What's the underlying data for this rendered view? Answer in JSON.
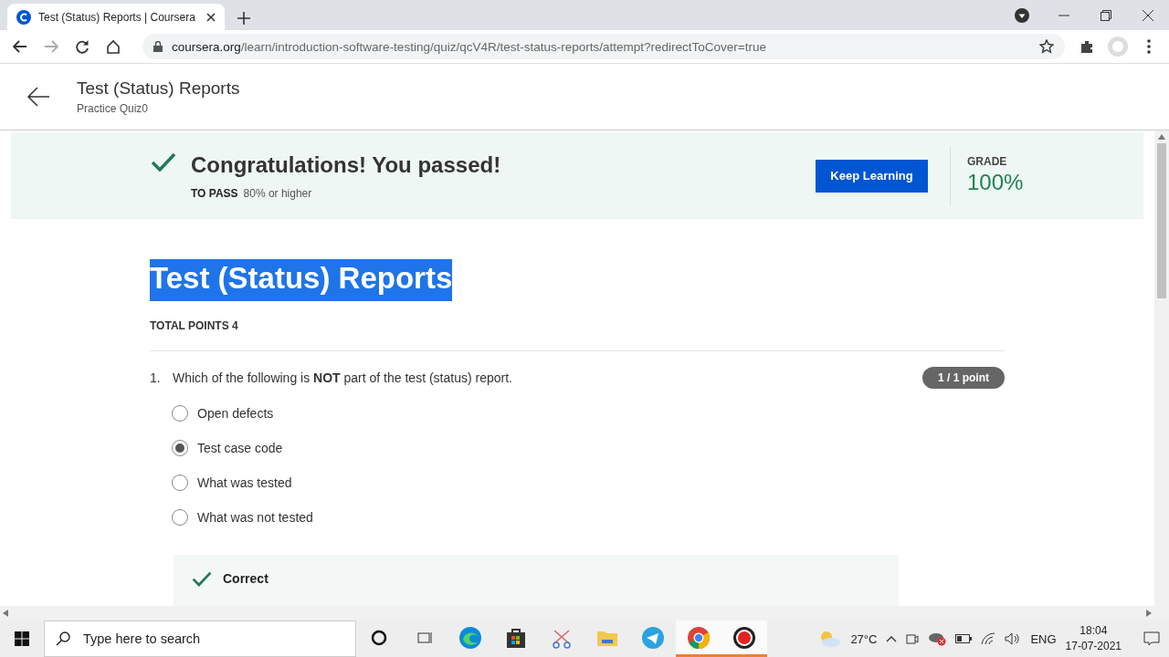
{
  "browser": {
    "tab": {
      "title": "Test (Status) Reports | Coursera",
      "selected": true
    },
    "url": {
      "host": "coursera.org",
      "path": "/learn/introduction-software-testing/quiz/qcV4R/test-status-reports/attempt?redirectToCover=true"
    }
  },
  "header": {
    "title": "Test (Status) Reports",
    "subtitle": "Practice Quiz0"
  },
  "result": {
    "heading": "Congratulations! You passed!",
    "pass_label": "TO PASS",
    "pass_value": "80% or higher",
    "button": "Keep Learning",
    "grade_label": "GRADE",
    "grade_value": "100%"
  },
  "quiz": {
    "title": "Test (Status) Reports",
    "title_highlighted": true,
    "total_points": "TOTAL POINTS 4",
    "questions": [
      {
        "number": "1.",
        "text": "Which of the following is  **NOT** part of the test (status) report.",
        "score": "1 / 1 point",
        "options": [
          {
            "label": "Open defects",
            "selected": false
          },
          {
            "label": "Test case code",
            "selected": true
          },
          {
            "label": "What was tested",
            "selected": false
          },
          {
            "label": "What was not tested",
            "selected": false
          }
        ],
        "feedback": {
          "verdict": "Correct"
        }
      }
    ]
  },
  "taskbar": {
    "search_placeholder": "Type here to search",
    "apps": [
      {
        "kind": "cortana",
        "active": false
      },
      {
        "kind": "taskview",
        "active": false
      },
      {
        "kind": "edge",
        "active": false
      },
      {
        "kind": "store",
        "active": false
      },
      {
        "kind": "snip",
        "active": false
      },
      {
        "kind": "folder",
        "active": false
      },
      {
        "kind": "telegram",
        "active": false
      },
      {
        "kind": "chrome",
        "active": true
      },
      {
        "kind": "record",
        "active": true
      }
    ],
    "temperature": "27°C",
    "language": "ENG",
    "time": "18:04",
    "date": "17-07-2021"
  }
}
